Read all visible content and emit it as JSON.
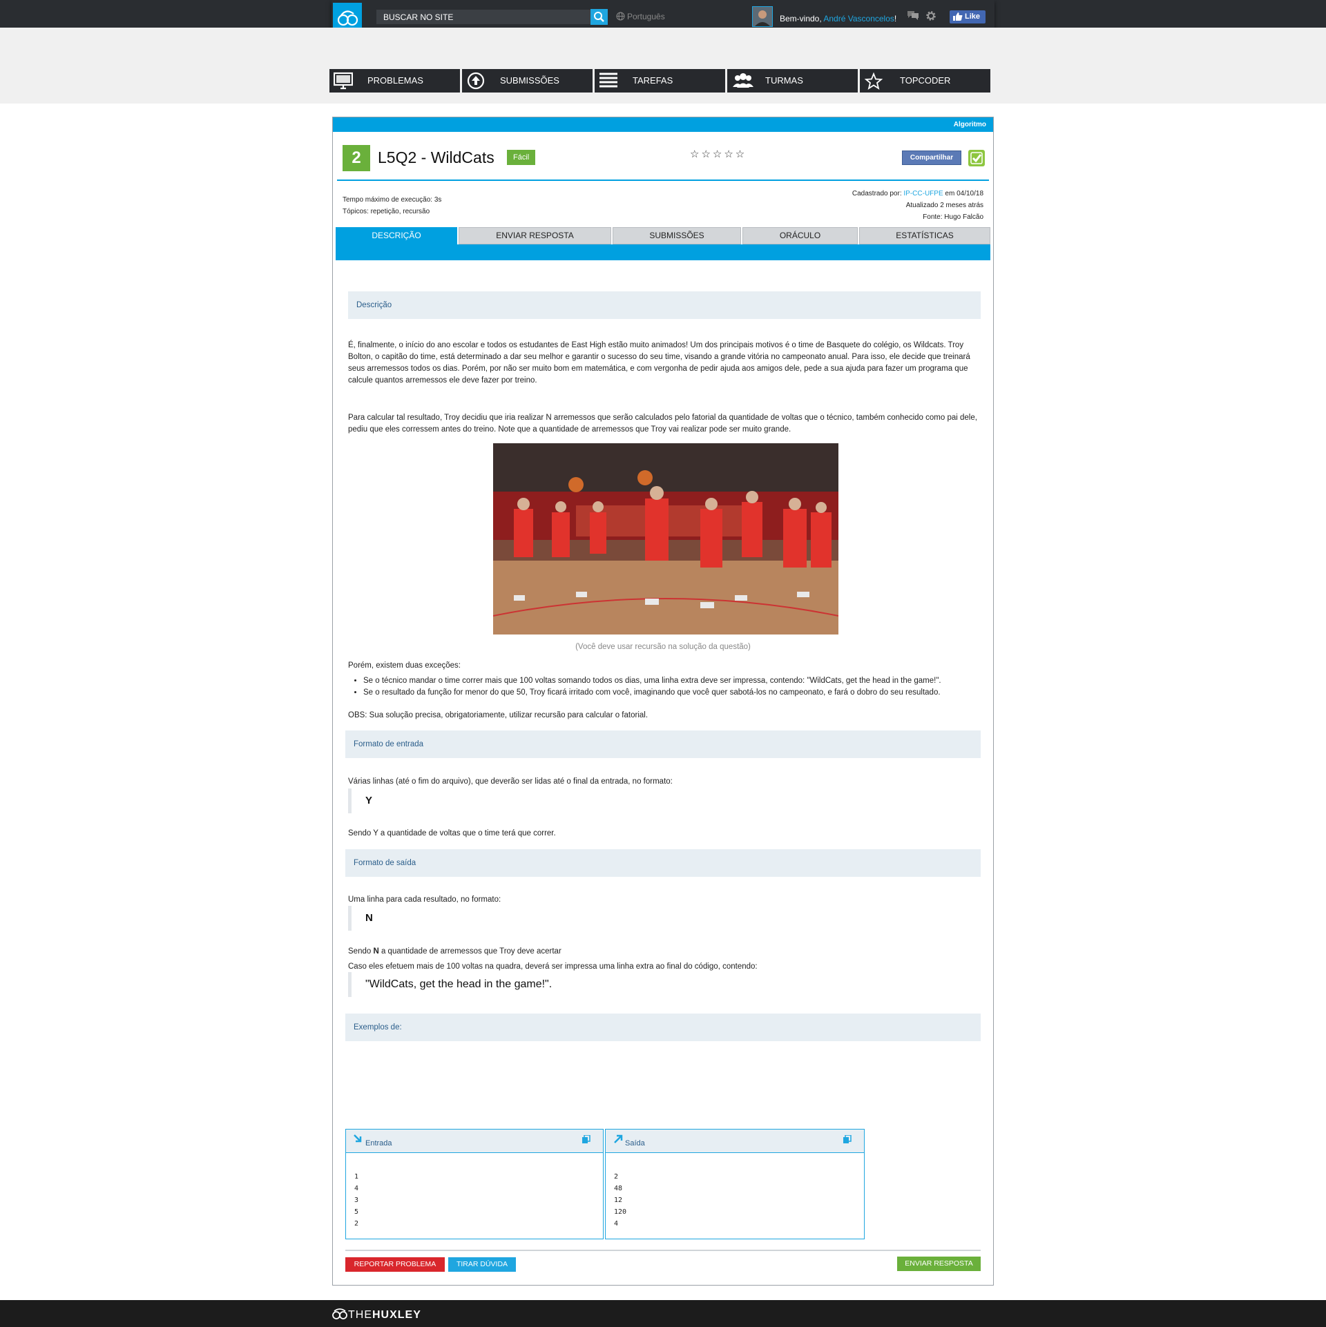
{
  "header": {
    "logo_icon": "huxley-goggles-icon",
    "search": {
      "placeholder": "BUSCAR NO SITE"
    },
    "language": "Português",
    "welcome_prefix": "Bem-vindo, ",
    "user_name": "André Vasconcelos",
    "welcome_suffix": "!",
    "like_label": "Like"
  },
  "nav": [
    {
      "label": "PROBLEMAS",
      "icon": "monitor-icon"
    },
    {
      "label": "SUBMISSÕES",
      "icon": "upload-circle-icon"
    },
    {
      "label": "TAREFAS",
      "icon": "list-icon"
    },
    {
      "label": "TURMAS",
      "icon": "group-icon"
    },
    {
      "label": "TOPCODER",
      "icon": "star-icon"
    }
  ],
  "problem": {
    "category": "Algoritmo",
    "level": "2",
    "title": "L5Q2 - WildCats",
    "difficulty": "Fácil",
    "stars": "☆☆☆☆☆",
    "share_label": "Compartilhar",
    "time_limit": "Tempo máximo de execução: 3s",
    "topics": "Tópicos: repetição, recursão",
    "registered_prefix": "Cadastrado por: ",
    "registered_by": "IP-CC-UFPE",
    "registered_date": " em 04/10/18",
    "updated": "Atualizado 2 meses atrás",
    "source": "Fonte: Hugo Falcão"
  },
  "tabs": [
    "DESCRIÇÃO",
    "ENVIAR RESPOSTA",
    "SUBMISSÕES",
    "ORÁCULO",
    "ESTATÍSTICAS"
  ],
  "description": {
    "heading": "Descrição",
    "p1": "É, finalmente, o início do ano escolar e todos os estudantes de East High estão muito animados! Um dos principais motivos é o time de Basquete do colégio, os Wildcats. Troy Bolton, o capitão do time, está determinado a dar seu melhor e garantir o sucesso do seu time, visando a grande vitória no campeonato anual. Para isso, ele decide que treinará seus arremessos todos os dias. Porém, por não ser muito bom em matemática, e com vergonha de pedir ajuda aos amigos dele, pede a sua ajuda para fazer um programa que calcule quantos arremessos ele deve fazer por treino.",
    "p2": "Para calcular tal resultado, Troy decidiu que iria realizar N arremessos que serão calculados pelo fatorial da quantidade de voltas que o técnico, também conhecido como pai dele, pediu que eles corressem antes do treino. Note que a quantidade de arremessos que Troy vai realizar pode ser muito grande.",
    "caption": "(Você deve usar recursão na solução da questão)",
    "exceptions_intro": "Porém, existem duas exceções:",
    "bullets": [
      "Se o técnico mandar o time correr mais que 100 voltas somando todos os dias, uma linha extra deve ser impressa, contendo: \"WildCats, get the head in the game!\".",
      "Se o resultado da função for menor do que 50, Troy ficará irritado com você, imaginando que você quer sabotá-los no campeonato, e fará o dobro do seu resultado."
    ],
    "obs": "OBS: Sua solução precisa, obrigatoriamente, utilizar recursão para calcular o fatorial."
  },
  "input_format": {
    "heading": "Formato de entrada",
    "p1": "Várias linhas (até o fim do arquivo), que deverão ser lidas até o final da entrada, no formato:",
    "quote": "Y",
    "p2": "Sendo Y a quantidade de voltas que o time terá que correr."
  },
  "output_format": {
    "heading": "Formato de saída",
    "p1": "Uma linha para cada resultado, no formato:",
    "quote": "N",
    "p2_prefix": "Sendo ",
    "p2_bold": "N",
    "p2_suffix": " a quantidade de arremessos que Troy deve acertar",
    "p3": "Caso eles efetuem mais de 100 voltas na quadra, deverá ser impressa uma linha extra ao final do código, contendo:",
    "quote2": "\"WildCats, get the head in the game!\"."
  },
  "examples": {
    "heading": "Exemplos de:",
    "input_label": "Entrada",
    "output_label": "Saída",
    "input": "1\n4\n3\n5\n2",
    "output": "2\n48\n12\n120\n4"
  },
  "buttons": {
    "report": "REPORTAR PROBLEMA",
    "ask": "TIRAR DÚVIDA",
    "submit": "ENVIAR RESPOSTA"
  },
  "footer": {
    "logo_thin": "THE",
    "logo_bold": "HUXLEY"
  },
  "colors": {
    "accent": "#00a0e0",
    "success": "#6ab03b",
    "danger": "#d9262c",
    "topbar": "#2a2d31",
    "nav": "#27292d"
  }
}
